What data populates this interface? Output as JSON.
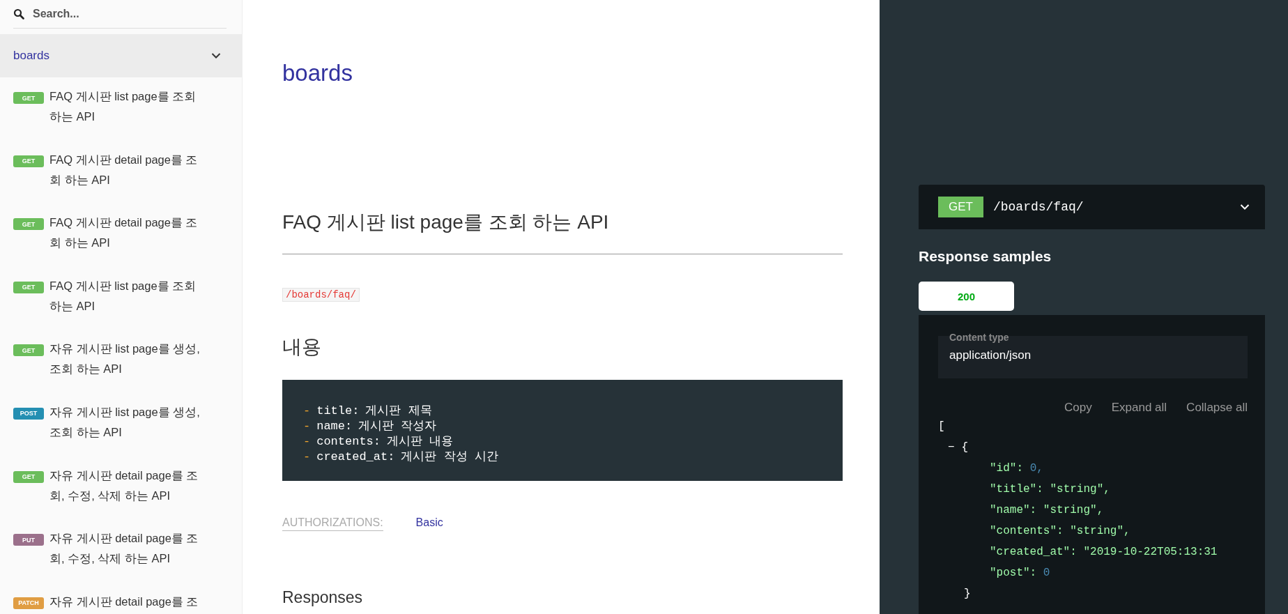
{
  "sidebar": {
    "search": {
      "placeholder": "Search..."
    },
    "group": {
      "label": "boards",
      "expanded": true
    },
    "items": [
      {
        "method": "GET",
        "label": "FAQ 게시판 list page를 조회 하는 API"
      },
      {
        "method": "GET",
        "label": "FAQ 게시판 detail page를 조회 하는 API"
      },
      {
        "method": "GET",
        "label": "FAQ 게시판 detail page를 조회 하는 API"
      },
      {
        "method": "GET",
        "label": "FAQ 게시판 list page를 조회 하는 API"
      },
      {
        "method": "GET",
        "label": "자유 게시판 list page를 생성, 조회 하는 API"
      },
      {
        "method": "POST",
        "label": "자유 게시판 list page를 생성, 조회 하는 API"
      },
      {
        "method": "GET",
        "label": "자유 게시판 detail page를 조회, 수정, 삭제 하는 API"
      },
      {
        "method": "PUT",
        "label": "자유 게시판 detail page를 조회, 수정, 삭제 하는 API"
      },
      {
        "method": "PATCH",
        "label": "자유 게시판 detail page를 조"
      }
    ]
  },
  "main": {
    "section_title": "boards",
    "operation_title": "FAQ 게시판 list page를 조회 하는 API",
    "path": "/boards/faq/",
    "description_heading": "내용",
    "fields": [
      {
        "dash": "-",
        "name": "title:",
        "desc": "게시판 제목"
      },
      {
        "dash": "-",
        "name": "name:",
        "desc": "게시판 작성자"
      },
      {
        "dash": "-",
        "name": "contents:",
        "desc": "게시판 내용"
      },
      {
        "dash": "-",
        "name": "created_at:",
        "desc": "게시판 작성 시간"
      }
    ],
    "authorizations_label": "AUTHORIZATIONS:",
    "authorization": "Basic",
    "responses_heading": "Responses"
  },
  "panel": {
    "endpoint": {
      "method": "GET",
      "path": "/boards/faq/",
      "expanded": true
    },
    "response_samples_heading": "Response samples",
    "status_tabs": [
      {
        "label": "200",
        "selected": true
      }
    ],
    "content_type_label": "Content type",
    "content_type": "application/json",
    "actions": [
      "Copy",
      "Expand all",
      "Collapse all"
    ],
    "json_open": "[",
    "object_toggle": "−",
    "object_open": "{",
    "json_lines": [
      {
        "key": "\"id\":",
        "value": "0,",
        "kind": "number"
      },
      {
        "key": "\"title\":",
        "value": "\"string\",",
        "kind": "string"
      },
      {
        "key": "\"name\":",
        "value": "\"string\",",
        "kind": "string"
      },
      {
        "key": "\"contents\":",
        "value": "\"string\",",
        "kind": "string"
      },
      {
        "key": "\"created_at\":",
        "value": "\"2019-10-22T05:13:31",
        "kind": "string"
      },
      {
        "key": "\"post\":",
        "value": "0",
        "kind": "number"
      }
    ],
    "object_close": "}"
  }
}
